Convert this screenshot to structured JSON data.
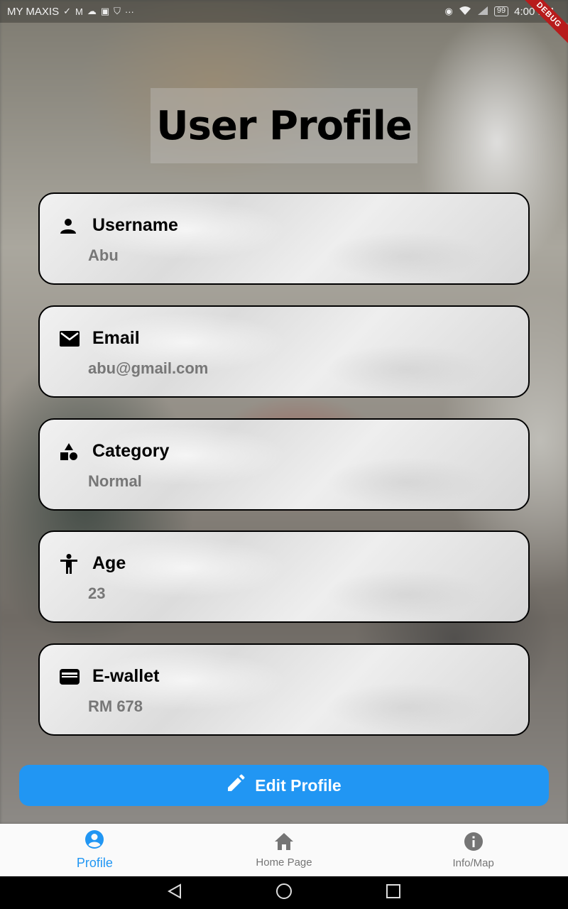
{
  "status_bar": {
    "carrier": "MY MAXIS",
    "battery": "99",
    "time": "4:00 PM"
  },
  "debug_banner": "DEBUG",
  "page_title": "User Profile",
  "fields": [
    {
      "icon": "person-icon",
      "label": "Username",
      "value": "Abu"
    },
    {
      "icon": "email-icon",
      "label": "Email",
      "value": "abu@gmail.com"
    },
    {
      "icon": "category-icon",
      "label": "Category",
      "value": "Normal"
    },
    {
      "icon": "accessibility-icon",
      "label": "Age",
      "value": "23"
    },
    {
      "icon": "wallet-icon",
      "label": "E-wallet",
      "value": "RM 678"
    }
  ],
  "edit_button": {
    "icon": "pencil-icon",
    "label": "Edit Profile"
  },
  "bottom_nav": [
    {
      "icon": "account-circle-icon",
      "label": "Profile",
      "active": true
    },
    {
      "icon": "home-icon",
      "label": "Home Page",
      "active": false
    },
    {
      "icon": "info-icon",
      "label": "Info/Map",
      "active": false
    }
  ],
  "colors": {
    "accent": "#2196f3",
    "inactive_nav": "#757575",
    "value_text": "#777777"
  }
}
